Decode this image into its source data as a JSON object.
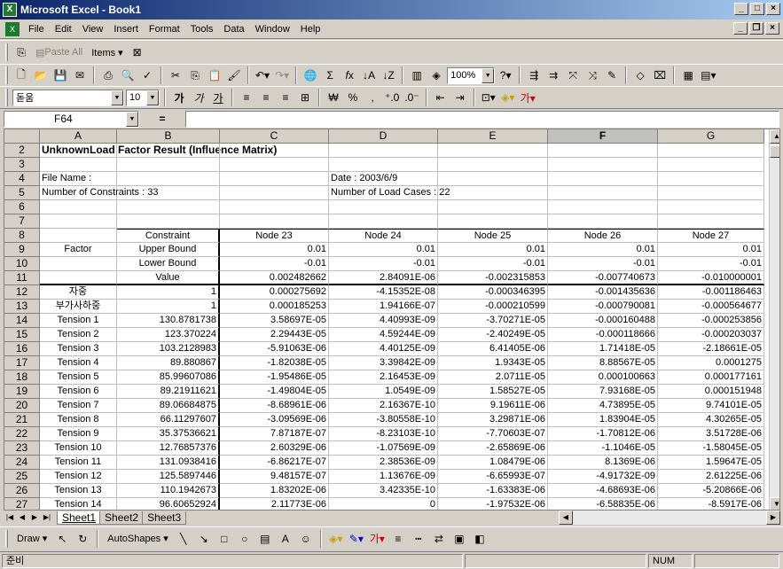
{
  "window": {
    "title": "Microsoft Excel - Book1",
    "app_icon": "excel-icon"
  },
  "menu": [
    "File",
    "Edit",
    "View",
    "Insert",
    "Format",
    "Tools",
    "Data",
    "Window",
    "Help"
  ],
  "toolbar_top": {
    "paste_all": "Paste All",
    "items": "Items ▾",
    "zoom": "100%"
  },
  "formatting": {
    "font": "돋움",
    "size": "10"
  },
  "formula_bar": {
    "name_box": "F64",
    "equals": "=",
    "formula": ""
  },
  "columns": [
    "A",
    "B",
    "C",
    "D",
    "E",
    "F",
    "G"
  ],
  "rows": [
    {
      "n": "2",
      "a": "UnknownLoad Factor Result (Influence Matrix)",
      "b": "",
      "c": "",
      "d": "",
      "e": "",
      "f": "",
      "g": ""
    },
    {
      "n": "3",
      "a": "",
      "b": "",
      "c": "",
      "d": "",
      "e": "",
      "f": "",
      "g": ""
    },
    {
      "n": "4",
      "a": "File Name :",
      "b": "",
      "c": "",
      "d": "Date : 2003/6/9",
      "e": "",
      "f": "",
      "g": ""
    },
    {
      "n": "5",
      "a": "Number of Constraints : 33",
      "b": "",
      "c": "",
      "d": "Number of Load Cases : 22",
      "e": "",
      "f": "",
      "g": ""
    },
    {
      "n": "6",
      "a": "",
      "b": "",
      "c": "",
      "d": "",
      "e": "",
      "f": "",
      "g": ""
    },
    {
      "n": "7",
      "a": "",
      "b": "",
      "c": "",
      "d": "",
      "e": "",
      "f": "",
      "g": ""
    },
    {
      "n": "8",
      "a": "",
      "b": "Constraint",
      "c": "Node 23",
      "d": "Node 24",
      "e": "Node 25",
      "f": "Node 26",
      "g": "Node 27"
    },
    {
      "n": "9",
      "a": "Factor",
      "b": "Upper Bound",
      "c": "0.01",
      "d": "0.01",
      "e": "0.01",
      "f": "0.01",
      "g": "0.01"
    },
    {
      "n": "10",
      "a": "",
      "b": "Lower Bound",
      "c": "-0.01",
      "d": "-0.01",
      "e": "-0.01",
      "f": "-0.01",
      "g": "-0.01"
    },
    {
      "n": "11",
      "a": "",
      "b": "Value",
      "c": "0.002482662",
      "d": "2.84091E-06",
      "e": "-0.002315853",
      "f": "-0.007740673",
      "g": "-0.010000001"
    },
    {
      "n": "12",
      "a": "자중",
      "b": "1",
      "c": "0.000275692",
      "d": "-4.15352E-08",
      "e": "-0.000346395",
      "f": "-0.001435636",
      "g": "-0.001186463"
    },
    {
      "n": "13",
      "a": "부가사하중",
      "b": "1",
      "c": "0.000185253",
      "d": "1.94166E-07",
      "e": "-0.000210599",
      "f": "-0.000790081",
      "g": "-0.000564677"
    },
    {
      "n": "14",
      "a": "Tension 1",
      "b": "130.8781738",
      "c": "3.58697E-05",
      "d": "4.40993E-09",
      "e": "-3.70271E-05",
      "f": "-0.000160488",
      "g": "-0.000253856"
    },
    {
      "n": "15",
      "a": "Tension 2",
      "b": "123.370224",
      "c": "2.29443E-05",
      "d": "4.59244E-09",
      "e": "-2.40249E-05",
      "f": "-0.000118666",
      "g": "-0.000203037"
    },
    {
      "n": "16",
      "a": "Tension 3",
      "b": "103.2128983",
      "c": "-5.91063E-06",
      "d": "4.40125E-09",
      "e": "6.41405E-06",
      "f": "1.71418E-05",
      "g": "-2.18661E-05"
    },
    {
      "n": "17",
      "a": "Tension 4",
      "b": "89.880867",
      "c": "-1.82038E-05",
      "d": "3.39842E-09",
      "e": "1.9343E-05",
      "f": "8.88567E-05",
      "g": "0.0001275"
    },
    {
      "n": "18",
      "a": "Tension 5",
      "b": "85.99607086",
      "c": "-1.95486E-05",
      "d": "2.16453E-09",
      "e": "2.0711E-05",
      "f": "0.000100663",
      "g": "0.000177161"
    },
    {
      "n": "19",
      "a": "Tension 6",
      "b": "89.21911621",
      "c": "-1.49804E-05",
      "d": "1.0549E-09",
      "e": "1.58527E-05",
      "f": "7.93168E-05",
      "g": "0.000151948"
    },
    {
      "n": "20",
      "a": "Tension 7",
      "b": "89.06684875",
      "c": "-8.68961E-06",
      "d": "2.16367E-10",
      "e": "9.19611E-06",
      "f": "4.73895E-05",
      "g": "9.74101E-05"
    },
    {
      "n": "21",
      "a": "Tension 8",
      "b": "66.11297607",
      "c": "-3.09569E-06",
      "d": "-3.80558E-10",
      "e": "3.29871E-06",
      "f": "1.83904E-05",
      "g": "4.30265E-05"
    },
    {
      "n": "22",
      "a": "Tension 9",
      "b": "35.37536621",
      "c": "7.87187E-07",
      "d": "-8.23103E-10",
      "e": "-7.70603E-07",
      "f": "-1.70812E-06",
      "g": "3.51728E-06"
    },
    {
      "n": "23",
      "a": "Tension 10",
      "b": "12.76857376",
      "c": "2.60329E-06",
      "d": "-1.07569E-09",
      "e": "-2.65869E-06",
      "f": "-1.1046E-05",
      "g": "-1.58045E-05"
    },
    {
      "n": "24",
      "a": "Tension 11",
      "b": "131.0938416",
      "c": "-6.86217E-07",
      "d": "2.38536E-09",
      "e": "1.08479E-06",
      "f": "8.1369E-06",
      "g": "1.59647E-05"
    },
    {
      "n": "25",
      "a": "Tension 12",
      "b": "125.5897446",
      "c": "9.48157E-07",
      "d": "1.13676E-09",
      "e": "-6.65993E-07",
      "f": "-4.91732E-09",
      "g": "2.61225E-06"
    },
    {
      "n": "26",
      "a": "Tension 13",
      "b": "110.1942673",
      "c": "1.83202E-06",
      "d": "3.42335E-10",
      "e": "-1.63383E-06",
      "f": "-4.68693E-06",
      "g": "-5.20866E-06"
    },
    {
      "n": "27",
      "a": "Tension 14",
      "b": "96.60652924",
      "c": "2.11773E-06",
      "d": "0",
      "e": "-1.97532E-06",
      "f": "-6.58835E-06",
      "g": "-8.5917E-06"
    }
  ],
  "sheets": [
    "Sheet1",
    "Sheet2",
    "Sheet3"
  ],
  "drawing": {
    "draw": "Draw ▾",
    "autoshapes": "AutoShapes ▾"
  },
  "status": {
    "ready": "준비",
    "num": "NUM"
  }
}
